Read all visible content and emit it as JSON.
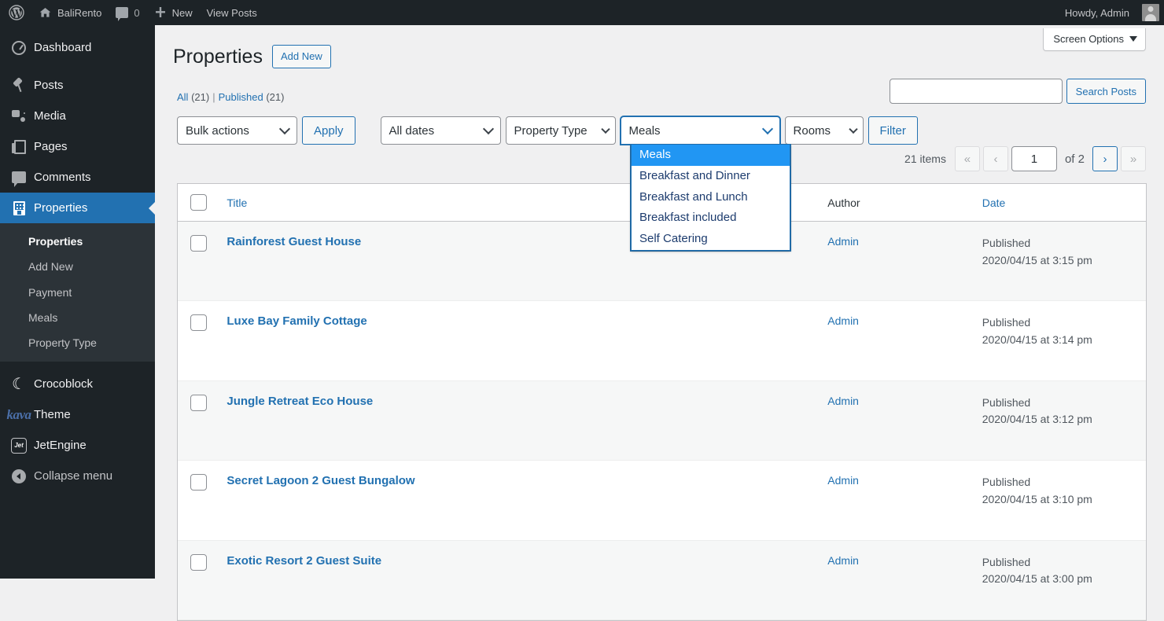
{
  "adminbar": {
    "logo_icon": "wordpress-logo-icon",
    "site_name": "BaliRento",
    "comments_count": "0",
    "new_label": "New",
    "view_posts_label": "View Posts",
    "howdy": "Howdy, Admin"
  },
  "sidebar": {
    "items": [
      {
        "label": "Dashboard",
        "icon": "dashboard-icon",
        "name": "dashboard"
      },
      {
        "label": "Posts",
        "icon": "pin-icon",
        "name": "posts"
      },
      {
        "label": "Media",
        "icon": "media-icon",
        "name": "media"
      },
      {
        "label": "Pages",
        "icon": "pages-icon",
        "name": "pages"
      },
      {
        "label": "Comments",
        "icon": "comment-icon",
        "name": "comments"
      },
      {
        "label": "Properties",
        "icon": "building-icon",
        "name": "properties",
        "current": true
      }
    ],
    "submenu": [
      {
        "label": "Properties",
        "active": true
      },
      {
        "label": "Add New",
        "active": false
      },
      {
        "label": "Payment",
        "active": false
      },
      {
        "label": "Meals",
        "active": false
      },
      {
        "label": "Property Type",
        "active": false
      }
    ],
    "plugins": [
      {
        "label": "Crocoblock",
        "icon": "crocoblock-icon"
      },
      {
        "label": "Theme",
        "icon": "kava-logo-icon",
        "logo_text": "kava"
      },
      {
        "label": "JetEngine",
        "icon": "jetengine-icon",
        "logo_text": "Jet"
      }
    ],
    "collapse_label": "Collapse menu",
    "collapse_icon": "collapse-arrow-icon"
  },
  "screen_options": {
    "label": "Screen Options",
    "icon": "chevron-down-icon"
  },
  "header": {
    "title": "Properties",
    "add_new_label": "Add New"
  },
  "views": {
    "all_label": "All",
    "all_count": "(21)",
    "separator": "|",
    "published_label": "Published",
    "published_count": "(21)"
  },
  "search": {
    "value": "",
    "placeholder": "",
    "button_label": "Search Posts"
  },
  "filters": {
    "bulk_actions": "Bulk actions",
    "apply_label": "Apply",
    "all_dates": "All dates",
    "property_type": "Property Type",
    "meals": "Meals",
    "rooms": "Rooms",
    "filter_label": "Filter"
  },
  "meals_dropdown": {
    "open": true,
    "selected": "Meals",
    "options": [
      "Meals",
      "Breakfast and Dinner",
      "Breakfast and Lunch",
      "Breakfast included",
      "Self Catering"
    ],
    "highlight_color": "#2196f3",
    "border_color": "#2271b1"
  },
  "pagination": {
    "items_label": "21 items",
    "first_icon": "«",
    "prev_icon": "‹",
    "current_page": "1",
    "of_label": "of 2",
    "next_icon": "›",
    "last_icon": "»"
  },
  "table": {
    "columns": {
      "checkbox": "select-all",
      "title": "Title",
      "author": "Author",
      "date": "Date"
    },
    "rows": [
      {
        "title": "Rainforest Guest House",
        "author": "Admin",
        "status": "Published",
        "date": "2020/04/15 at 3:15 pm"
      },
      {
        "title": "Luxe Bay Family Cottage",
        "author": "Admin",
        "status": "Published",
        "date": "2020/04/15 at 3:14 pm"
      },
      {
        "title": "Jungle Retreat Eco House",
        "author": "Admin",
        "status": "Published",
        "date": "2020/04/15 at 3:12 pm"
      },
      {
        "title": "Secret Lagoon 2 Guest Bungalow",
        "author": "Admin",
        "status": "Published",
        "date": "2020/04/15 at 3:10 pm"
      },
      {
        "title": "Exotic Resort 2 Guest Suite",
        "author": "Admin",
        "status": "Published",
        "date": "2020/04/15 at 3:00 pm"
      }
    ]
  },
  "colors": {
    "admin_bar": "#1d2327",
    "sidebar": "#1d2327",
    "submenu": "#2c3338",
    "current_menu": "#2271b1",
    "link": "#2271b1",
    "content_bg": "#f0f0f1"
  }
}
